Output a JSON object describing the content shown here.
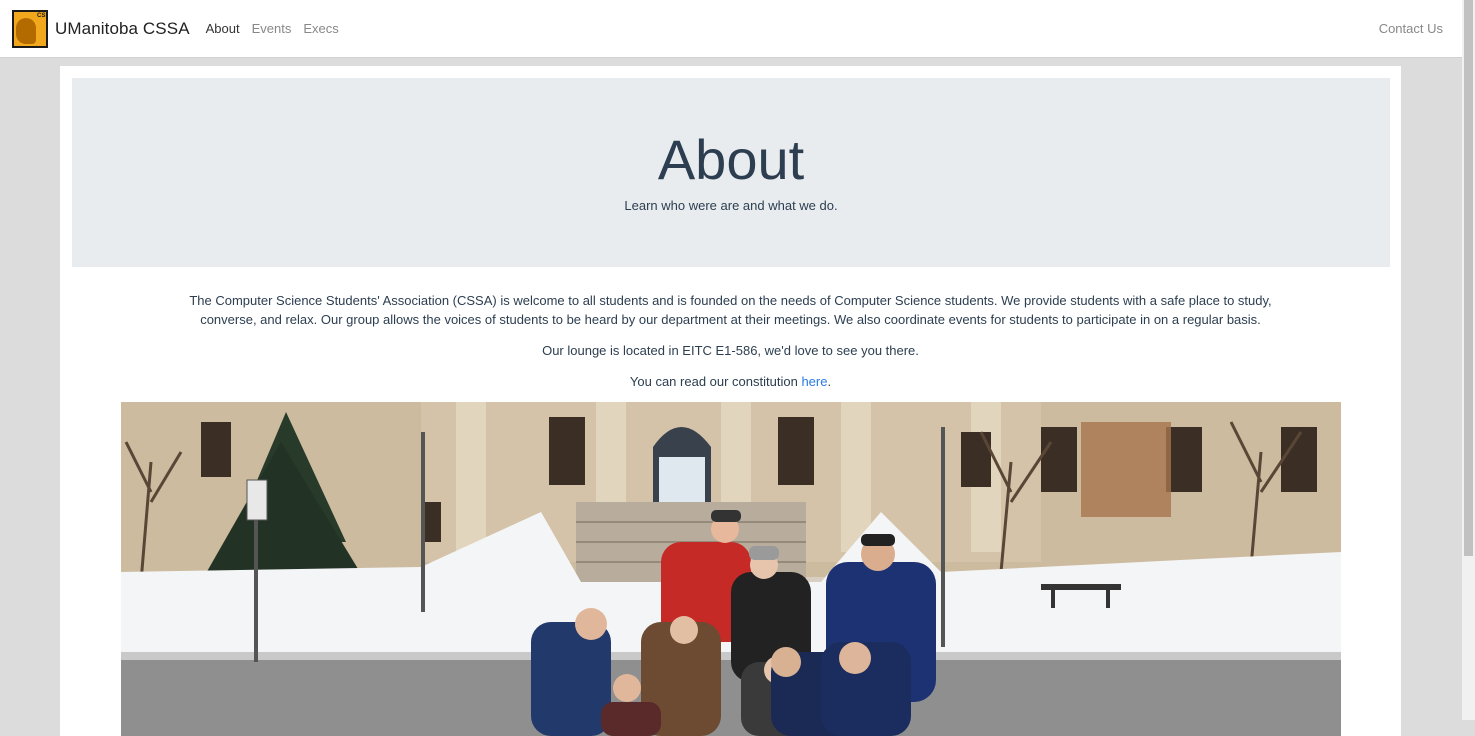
{
  "nav": {
    "brand_name": "UManitoba CSSA",
    "logo_letters": "CSSA",
    "links": [
      {
        "label": "About",
        "active": true
      },
      {
        "label": "Events",
        "active": false
      },
      {
        "label": "Execs",
        "active": false
      }
    ],
    "contact_label": "Contact Us"
  },
  "jumbotron": {
    "title": "About",
    "subtitle": "Learn who were are and what we do."
  },
  "content": {
    "intro": "The Computer Science Students' Association (CSSA) is welcome to all students and is founded on the needs of Computer Science students. We provide students with a safe place to study, converse, and relax. Our group allows the voices of students to be heard by our department at their meetings. We also coordinate events for students to participate in on a regular basis.",
    "lounge": "Our lounge is located in EITC E1-586, we'd love to see you there.",
    "constitution_prefix": "You can read our constitution ",
    "constitution_link": "here",
    "constitution_suffix": "."
  },
  "colors": {
    "accent": "#2a7ae2",
    "heading": "#2c3e50",
    "jumbotron_bg": "#e9ecef",
    "page_bg": "#dcdcdc"
  }
}
